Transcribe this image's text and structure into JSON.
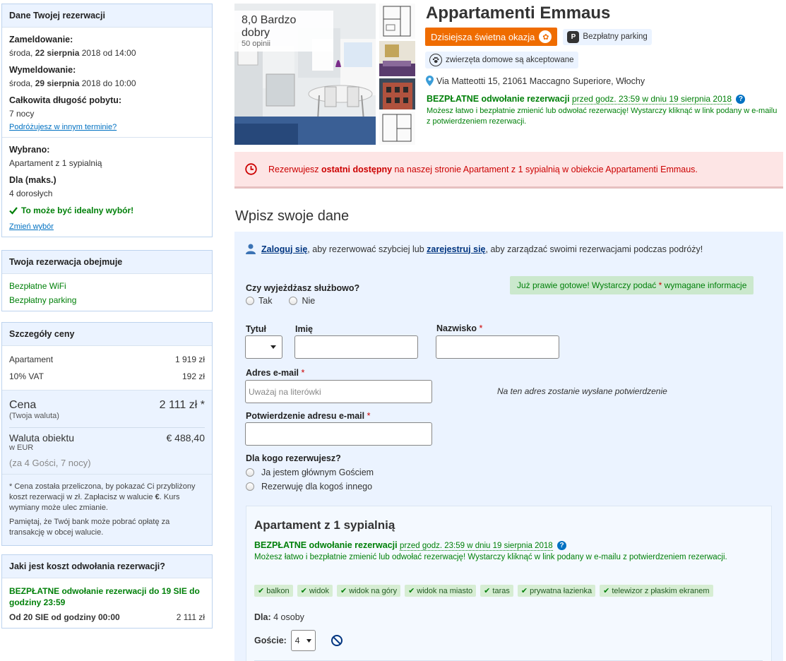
{
  "reservation": {
    "header": "Dane Twojej rezerwacji",
    "checkin_label": "Zameldowanie:",
    "checkin_day": "środa,",
    "checkin_date": "22 sierpnia",
    "checkin_rest": "2018 od 14:00",
    "checkout_label": "Wymeldowanie:",
    "checkout_day": "środa,",
    "checkout_date": "29 sierpnia",
    "checkout_rest": "2018 do 10:00",
    "stay_label": "Całkowita długość pobytu:",
    "stay_value": "7 nocy",
    "other_dates_link": "Podróżujesz w innym terminie?",
    "selected_label": "Wybrano:",
    "selected_value": "Apartament z 1 sypialnią",
    "max_label": "Dla (maks.)",
    "max_value": "4 dorosłych",
    "good_choice": "To może być idealny wybór!",
    "change_link": "Zmień wybór"
  },
  "includes": {
    "header": "Twoja rezerwacja obejmuje",
    "items": [
      "Bezpłatne WiFi",
      "Bezpłatny parking"
    ]
  },
  "price": {
    "header": "Szczegóły ceny",
    "rows": [
      {
        "label": "Apartament",
        "value": "1 919 zł"
      },
      {
        "label": "10% VAT",
        "value": "192 zł"
      }
    ],
    "total_label": "Cena",
    "total_value": "2 111 zł *",
    "total_sub": "(Twoja waluta)",
    "local_label": "Waluta obiektu",
    "local_value": "€ 488,40",
    "local_sub": "w EUR",
    "guests_nights": "(za 4 Gości, 7 nocy)",
    "note1_pre": "* Cena została przeliczona, by pokazać Ci przybliżony koszt rezerwacji w zł. Zapłacisz w walucie ",
    "note1_currency": "€",
    "note1_post": ". Kurs wymiany może ulec zmianie.",
    "note2": "Pamiętaj, że Twój bank może pobrać opłatę za transakcję w obcej walucie."
  },
  "cancellation": {
    "header": "Jaki jest koszt odwołania rezerwacji?",
    "free_text": "BEZPŁATNE odwołanie rezerwacji do 19 SIE do godziny 23:59",
    "from_label": "Od 20 SIE od godziny 00:00",
    "from_value": "2 111 zł"
  },
  "hotel": {
    "name": "Appartamenti Emmaus",
    "score": "8,0 Bardzo dobry",
    "reviews": "50 opinii",
    "deal_badge": "Dzisiejsza świetna okazja",
    "parking": "Bezpłatny parking",
    "pets": "zwierzęta domowe są akceptowane",
    "address": "Via Matteotti 15, 21061 Maccagno Superiore, Włochy",
    "free_cancel_title": "BEZPŁATNE odwołanie rezerwacji",
    "free_cancel_until": "przed godz. 23:59 w dniu 19 sierpnia 2018",
    "free_cancel_desc": "Możesz łatwo i bezpłatnie zmienić lub odwołać rezerwację! Wystarczy kliknąć w link podany w e-mailu z potwierdzeniem rezerwacji."
  },
  "alert": {
    "pre": "Rezerwujesz ",
    "bold": "ostatni dostępny",
    "post": " na naszej stronie Apartament z 1 sypialnią w obiekcie Appartamenti Emmaus."
  },
  "form": {
    "section_title": "Wpisz swoje dane",
    "login_link": "Zaloguj się",
    "login_mid": ", aby rezerwować szybciej lub ",
    "register_link": "zarejestruj się",
    "login_post": ", aby zarządzać swoimi rezerwacjami podczas podróży!",
    "ready_pre": "Już prawie gotowe! Wystarczy podać ",
    "ready_star": "*",
    "ready_post": " wymagane informacje",
    "business_label": "Czy wyjeżdżasz służbowo?",
    "yes": "Tak",
    "no": "Nie",
    "title_label": "Tytuł",
    "first_label": "Imię",
    "last_label": "Nazwisko",
    "req_star": "*",
    "email_label": "Adres e-mail",
    "email_placeholder": "Uważaj na literówki",
    "email_hint": "Na ten adres zostanie wysłane potwierdzenie",
    "email_confirm_label": "Potwierdzenie adresu e-mail",
    "for_whom_label": "Dla kogo rezerwujesz?",
    "for_me": "Ja jestem głównym Gościem",
    "for_other": "Rezerwuję dla kogoś innego"
  },
  "room": {
    "title": "Apartament z 1 sypialnią",
    "cancel_title": "BEZPŁATNE odwołanie rezerwacji",
    "cancel_until": "przed godz. 23:59 w dniu 19 sierpnia 2018",
    "cancel_desc": "Możesz łatwo i bezpłatnie zmienić lub odwołać rezerwację! Wystarczy kliknąć w link podany w e-mailu z potwierdzeniem rezerwacji.",
    "facilities": [
      "balkon",
      "widok",
      "widok na góry",
      "widok na miasto",
      "taras",
      "prywatna łazienka",
      "telewizor z płaskim ekranem"
    ],
    "for_label": "Dla:",
    "for_value": "4 osoby",
    "guests_label": "Goście:",
    "guests_value": "4"
  },
  "colors": {
    "brand_blue": "#003580",
    "link_blue": "#0071c2",
    "green": "#008009",
    "deal_orange": "#ef6c00",
    "alert_red": "#cc0000"
  }
}
